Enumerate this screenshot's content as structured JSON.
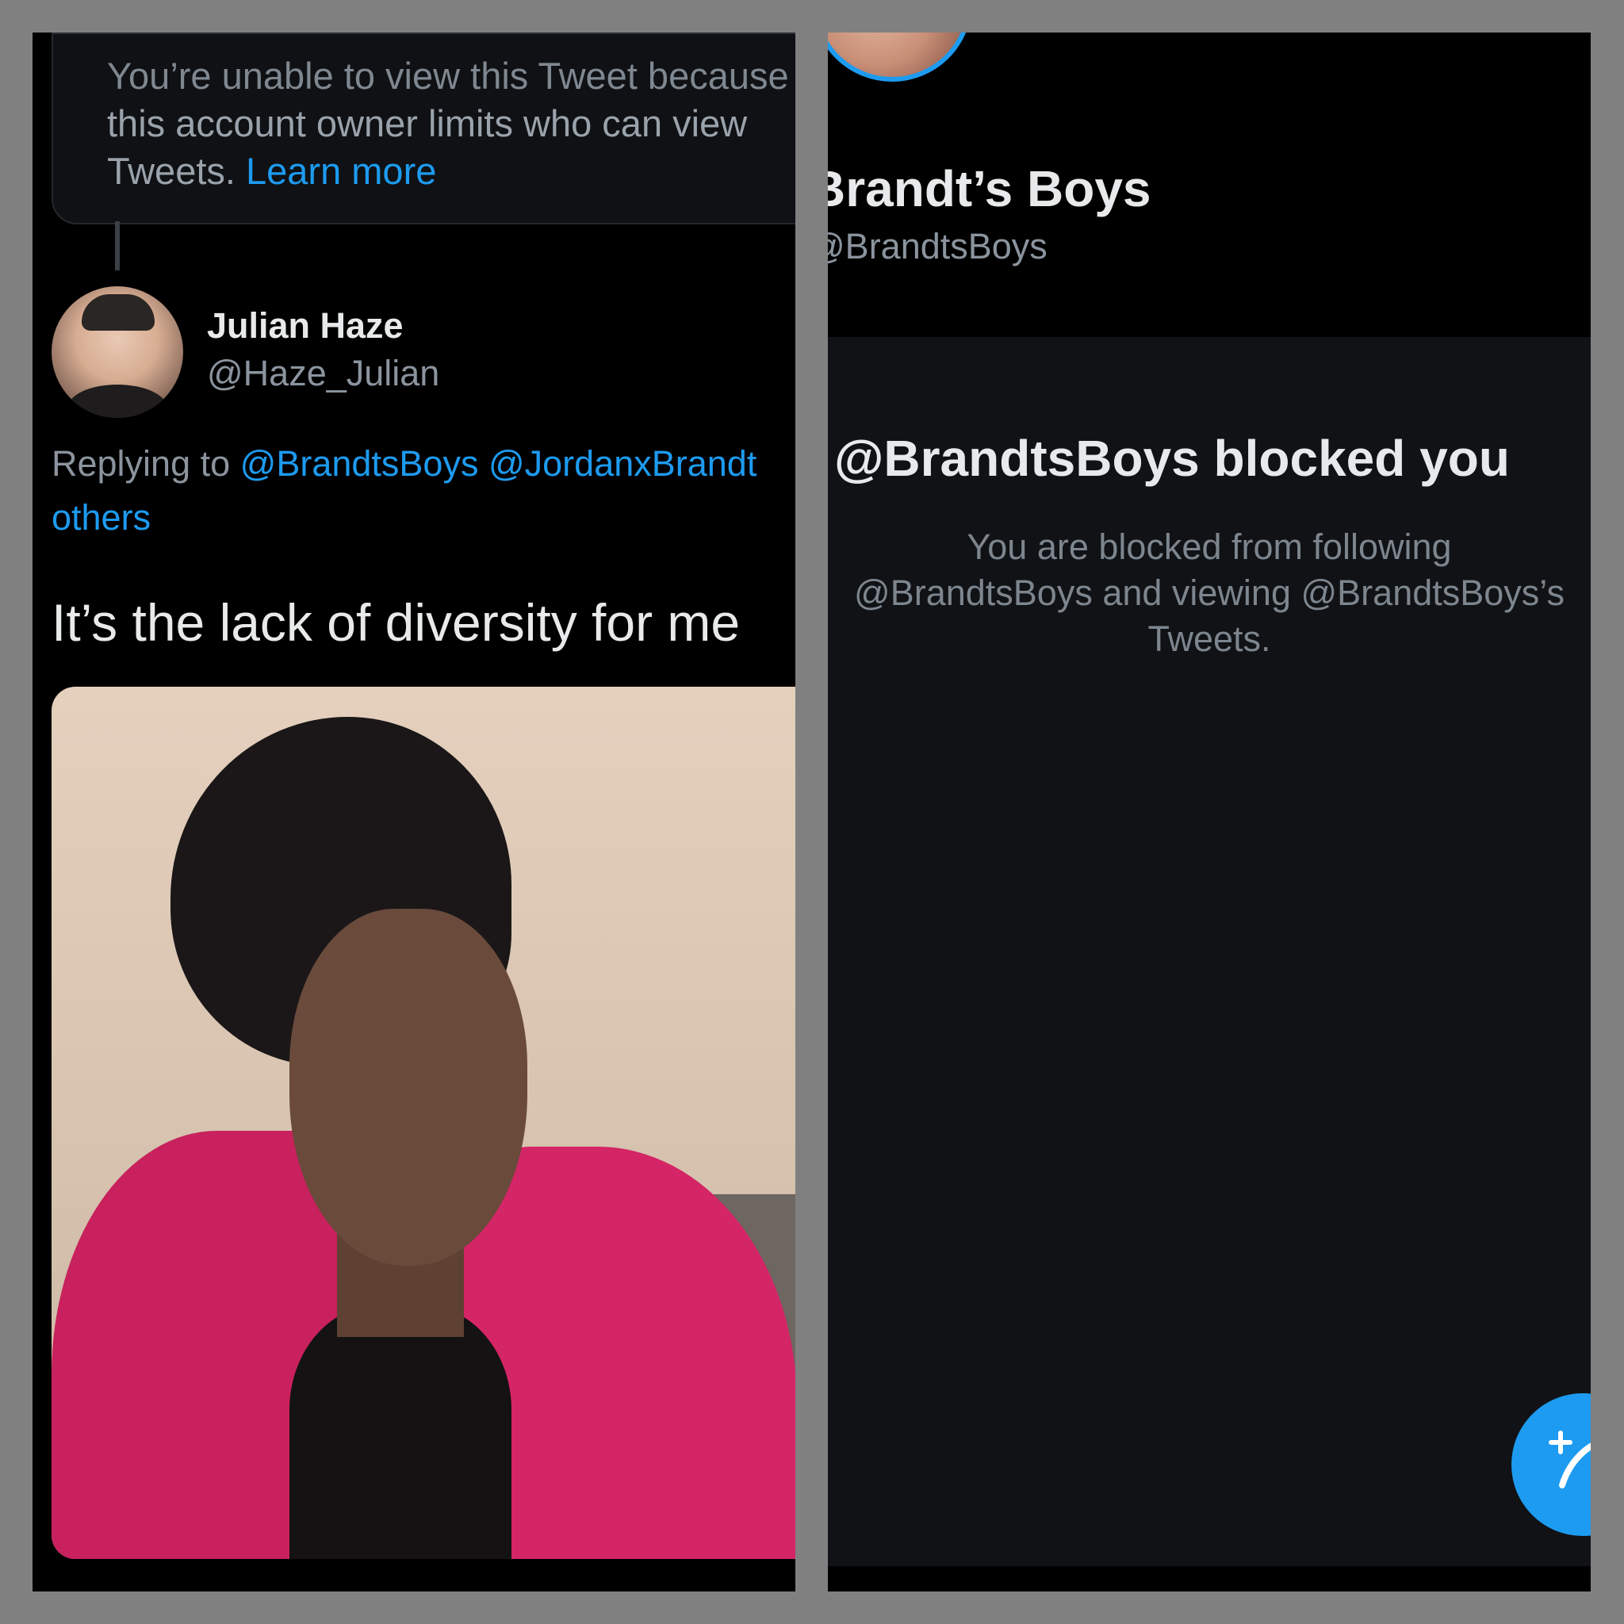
{
  "left": {
    "limited_notice": {
      "line1": "You’re unable to view this Tweet because",
      "line2": "this account owner limits who can view",
      "line3_prefix": "Tweets. ",
      "learn_more": "Learn more"
    },
    "author": {
      "name": "Julian Haze",
      "handle": "@Haze_Julian"
    },
    "reply": {
      "prefix": "Replying to ",
      "mention1": "@BrandtsBoys",
      "mention2": "@JordanxBrandt",
      "others": "others"
    },
    "tweet_text": "It’s the lack of diversity for me"
  },
  "right": {
    "profile": {
      "name": "Brandt’s Boys",
      "handle": "@BrandtsBoys"
    },
    "blocked": {
      "title": "@BrandtsBoys blocked you",
      "line1": "You are blocked from following",
      "line2": "@BrandtsBoys and viewing @BrandtsBoys’s",
      "line3": "Tweets."
    },
    "fab_icon": "compose-tweet-icon"
  },
  "colors": {
    "frame": "#808080",
    "background": "#000000",
    "card": "#101216",
    "accent": "#1d9bf0",
    "text_primary": "#e7e9ea",
    "text_secondary": "#8b949e"
  }
}
